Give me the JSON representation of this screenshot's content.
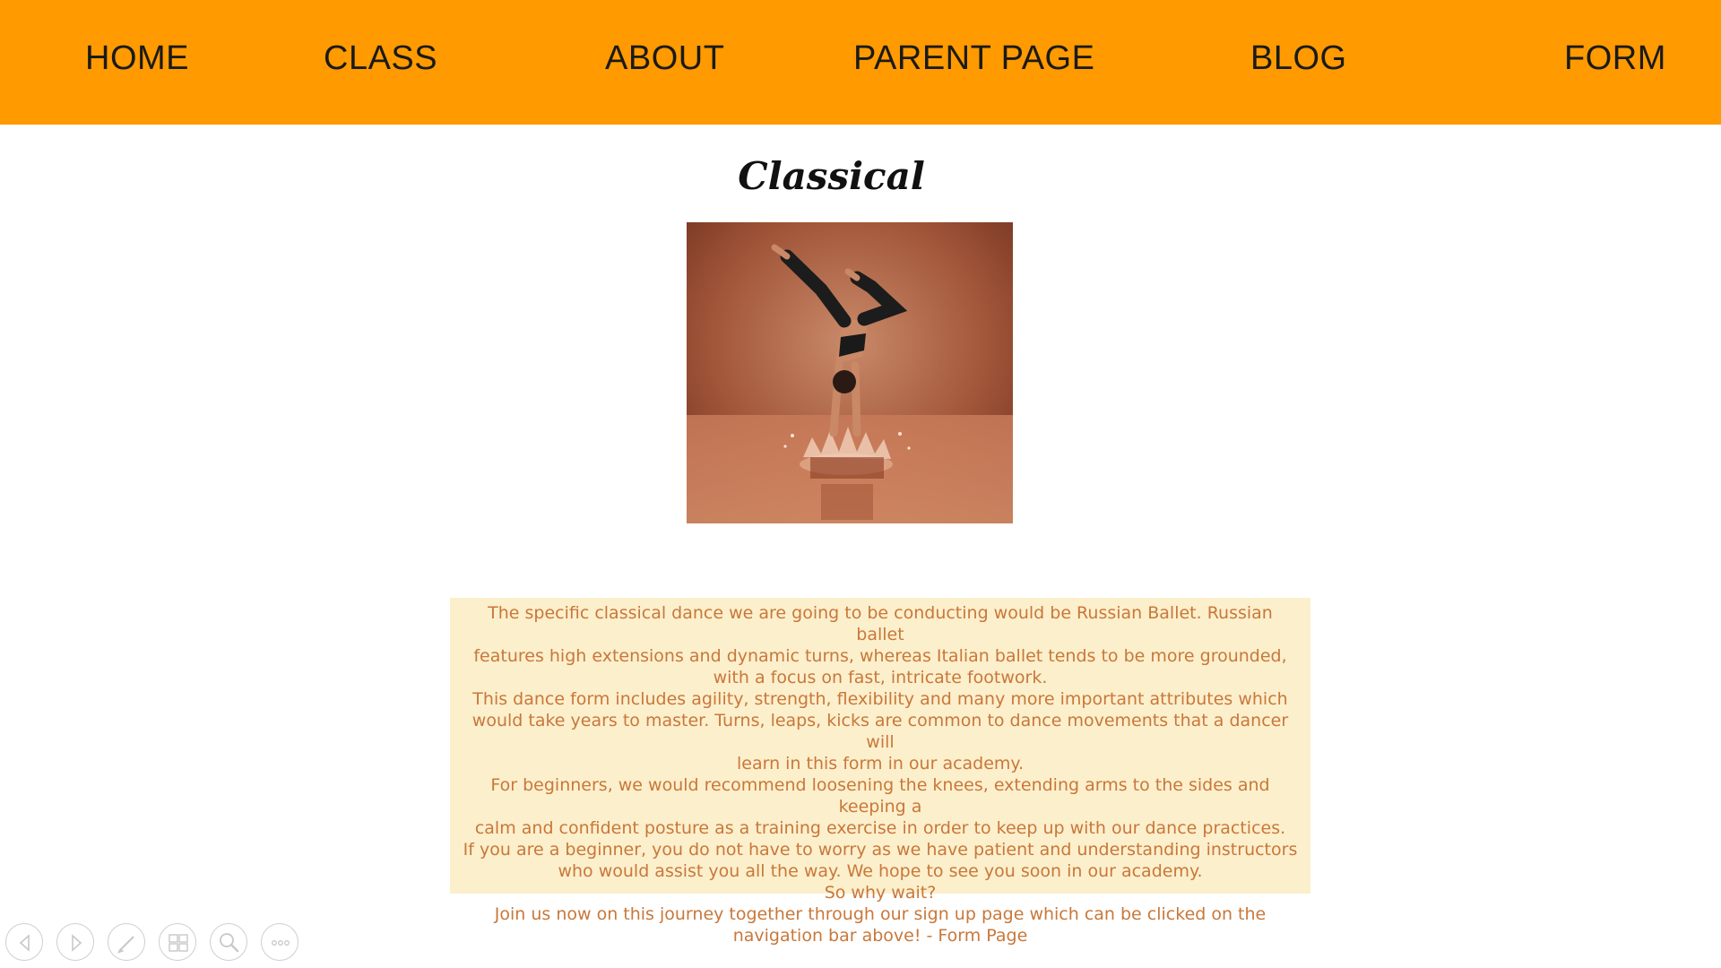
{
  "nav": {
    "items": [
      {
        "label": "HOME"
      },
      {
        "label": "CLASS"
      },
      {
        "label": "ABOUT"
      },
      {
        "label": "PARENT PAGE"
      },
      {
        "label": "BLOG"
      },
      {
        "label": "FORM"
      }
    ],
    "background": "#ff9a00"
  },
  "page": {
    "title": "Classical"
  },
  "description": {
    "lines": [
      "The specific classical dance we are going to be conducting would be Russian Ballet. Russian ballet",
      "features high extensions and dynamic turns, whereas Italian ballet tends to be more grounded,",
      "with a focus on fast, intricate footwork.",
      "This dance form includes agility, strength, flexibility and many more important attributes which",
      "would take years to master. Turns, leaps, kicks are common to dance movements that a dancer will",
      "learn in this form in our academy.",
      "For beginners, we would recommend loosening the knees, extending arms to the sides and keeping a",
      "calm and confident posture as a training exercise in order to keep up with our dance practices.",
      "If you are a beginner, you do not have to worry as we have patient and understanding instructors",
      "who would assist you all the way. We hope to see you soon in our academy.",
      "So why wait?",
      "Join us now on this journey together through our sign up page which can be clicked on the",
      "navigation bar above! - Form Page"
    ],
    "background": "#fcefcc",
    "text_color": "#c8783a"
  },
  "controls": {
    "icons": [
      "previous-icon",
      "next-icon",
      "pen-icon",
      "slides-icon",
      "zoom-icon",
      "more-icon"
    ]
  }
}
